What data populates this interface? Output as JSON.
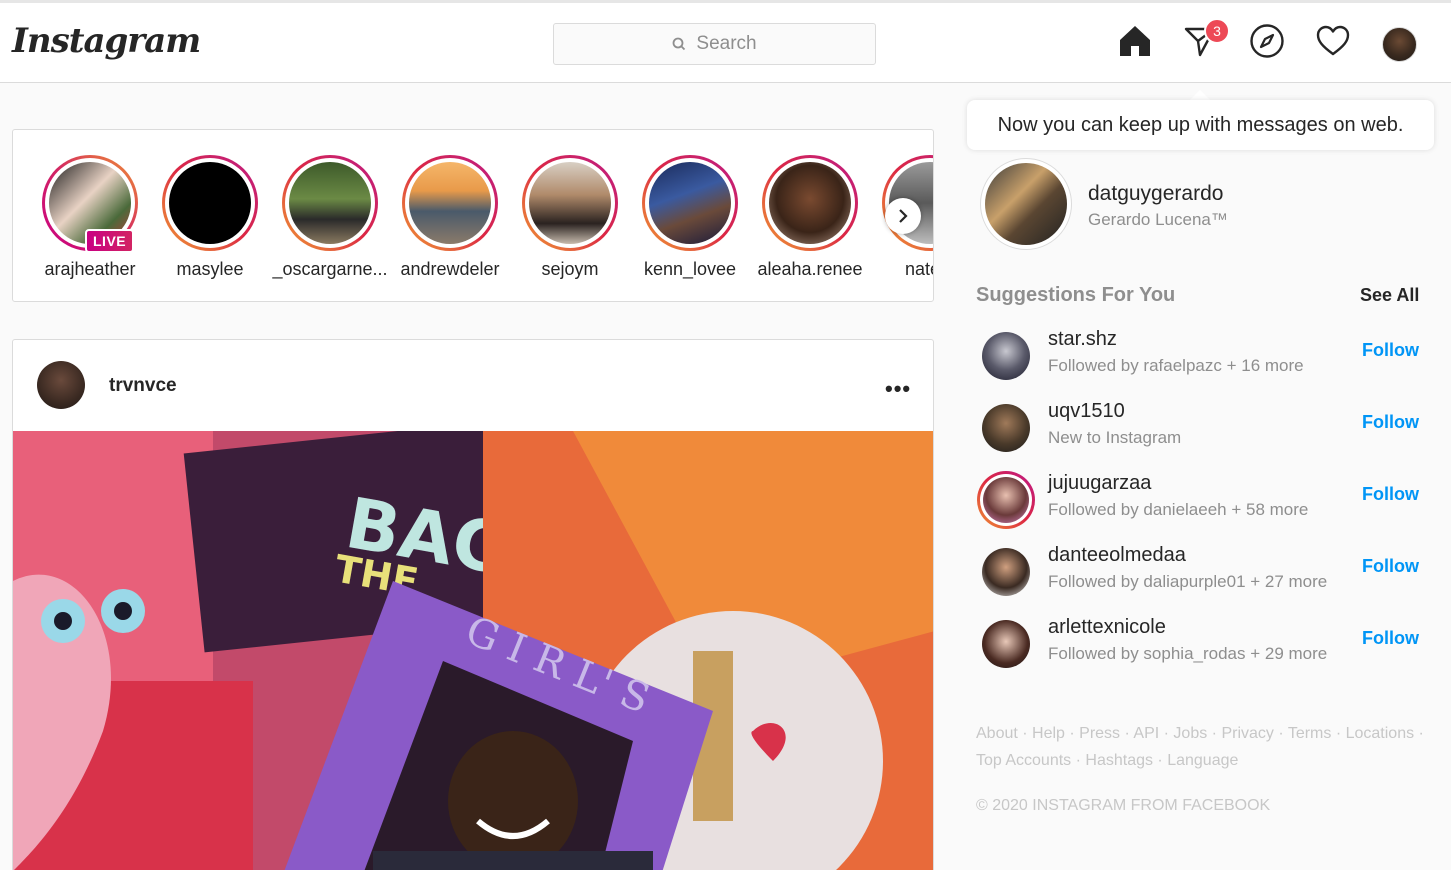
{
  "header": {
    "logo_text": "Instagram",
    "search_placeholder": "Search",
    "messages_badge": "3",
    "icons": [
      "home-icon",
      "direct-icon",
      "explore-icon",
      "heart-icon"
    ]
  },
  "tooltip": {
    "text": "Now you can keep up with messages on web."
  },
  "stories": [
    {
      "name": "arajheather",
      "live": "LIVE"
    },
    {
      "name": "masylee"
    },
    {
      "name": "_oscargarne..."
    },
    {
      "name": "andrewdeler"
    },
    {
      "name": "sejoym"
    },
    {
      "name": "kenn_lovee"
    },
    {
      "name": "aleaha.renee"
    },
    {
      "name": "nate.b"
    }
  ],
  "post": {
    "username": "trvnvce",
    "more": "•••"
  },
  "profile": {
    "username": "datguygerardo",
    "full_name": "Gerardo Lucena™"
  },
  "suggestions": {
    "title": "Suggestions For You",
    "see_all": "See All",
    "items": [
      {
        "username": "star.shz",
        "subtitle": "Followed by rafaelpazc + 16 more",
        "action": "Follow"
      },
      {
        "username": "uqv1510",
        "subtitle": "New to Instagram",
        "action": "Follow"
      },
      {
        "username": "jujuugarzaa",
        "subtitle": "Followed by danielaeeh + 58 more",
        "action": "Follow"
      },
      {
        "username": "danteeolmedaa",
        "subtitle": "Followed by daliapurple01 + 27 more",
        "action": "Follow"
      },
      {
        "username": "arlettexnicole",
        "subtitle": "Followed by sophia_rodas + 29 more",
        "action": "Follow"
      }
    ]
  },
  "footer": {
    "links": [
      "About",
      "Help",
      "Press",
      "API",
      "Jobs",
      "Privacy",
      "Terms",
      "Locations",
      "Top Accounts",
      "Hashtags",
      "Language"
    ],
    "copyright": "© 2020 INSTAGRAM FROM FACEBOOK"
  },
  "colors": {
    "accent": "#0095f6",
    "badge": "#ed4956",
    "border": "#dbdbdb"
  }
}
